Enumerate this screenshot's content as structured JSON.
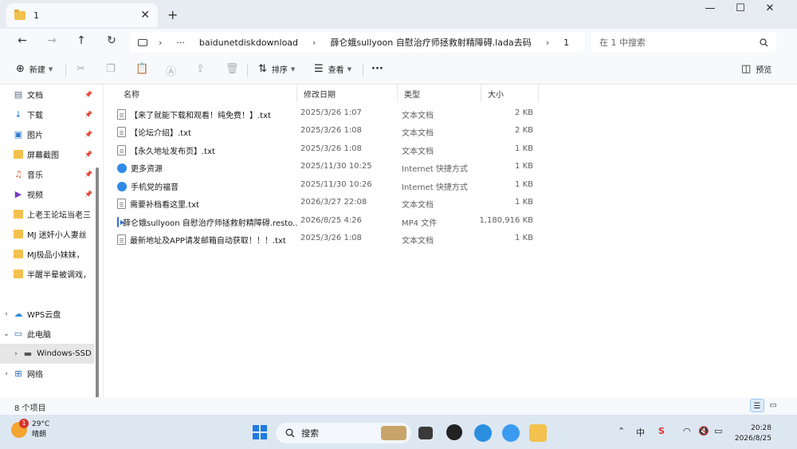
{
  "tab": {
    "title": "1"
  },
  "window": {
    "minimize": "—",
    "maximize": "☐",
    "close": "✕"
  },
  "address": {
    "more": "···",
    "crumbs": [
      "baidunetdiskdownload",
      "薛仑娥sullyoon 自慰治疗师拯救射精障碍.lada去码",
      "1"
    ],
    "sep": "›"
  },
  "search": {
    "placeholder": "在 1 中搜索"
  },
  "toolbar": {
    "new_label": "新建",
    "sort_label": "排序",
    "view_label": "查看",
    "more_label": "···",
    "preview_label": "预览"
  },
  "sidebar": {
    "items": [
      {
        "label": "文档",
        "icon": "document-icon",
        "pinned": true
      },
      {
        "label": "下载",
        "icon": "download-icon",
        "pinned": true
      },
      {
        "label": "图片",
        "icon": "image-icon",
        "pinned": true
      },
      {
        "label": "屏幕截图",
        "icon": "folder-icon",
        "pinned": true
      },
      {
        "label": "音乐",
        "icon": "music-icon",
        "pinned": true
      },
      {
        "label": "视频",
        "icon": "video-icon",
        "pinned": true
      },
      {
        "label": "上老王论坛当老三",
        "icon": "folder-icon",
        "pinned": false
      },
      {
        "label": "MJ 迷奸小人妻丝",
        "icon": "folder-icon",
        "pinned": false
      },
      {
        "label": "MJ极品小妹妹，",
        "icon": "folder-icon",
        "pinned": false
      },
      {
        "label": "半醒半晕被调戏，",
        "icon": "folder-icon",
        "pinned": false
      },
      {
        "label": "WPS云盘",
        "icon": "cloud-icon",
        "pinned": false
      },
      {
        "label": "此电脑",
        "icon": "computer-icon",
        "pinned": false
      },
      {
        "label": "Windows-SSD",
        "icon": "drive-icon",
        "pinned": false
      },
      {
        "label": "网络",
        "icon": "network-icon",
        "pinned": false
      }
    ]
  },
  "columns": {
    "name": "名称",
    "modified": "修改日期",
    "type": "类型",
    "size": "大小"
  },
  "files": [
    {
      "name": "【来了就能下载和观看！纯免费！】.txt",
      "modified": "2025/3/26 1:07",
      "type": "文本文档",
      "size": "2 KB",
      "icon": "text-file-icon"
    },
    {
      "name": "【论坛介绍】.txt",
      "modified": "2025/3/26 1:08",
      "type": "文本文档",
      "size": "2 KB",
      "icon": "text-file-icon"
    },
    {
      "name": "【永久地址发布页】.txt",
      "modified": "2025/3/26 1:08",
      "type": "文本文档",
      "size": "1 KB",
      "icon": "text-file-icon"
    },
    {
      "name": "更多资源",
      "modified": "2025/11/30 10:25",
      "type": "Internet 快捷方式",
      "size": "1 KB",
      "icon": "internet-shortcut-icon"
    },
    {
      "name": "手机党的福音",
      "modified": "2025/11/30 10:26",
      "type": "Internet 快捷方式",
      "size": "1 KB",
      "icon": "internet-shortcut-icon"
    },
    {
      "name": "需要补档看这里.txt",
      "modified": "2026/3/27 22:08",
      "type": "文本文档",
      "size": "1 KB",
      "icon": "text-file-icon"
    },
    {
      "name": "薛仑娥sullyoon 自慰治疗师拯救射精障碍.resto...",
      "modified": "2026/8/25 4:26",
      "type": "MP4 文件",
      "size": "1,180,916 KB",
      "icon": "video-file-icon"
    },
    {
      "name": "最新地址及APP请发邮箱自动获取！！！.txt",
      "modified": "2025/3/26 1:08",
      "type": "文本文档",
      "size": "1 KB",
      "icon": "text-file-icon"
    }
  ],
  "status": {
    "count": "8 个项目"
  },
  "taskbar": {
    "weather_temp": "29°C",
    "weather_desc": "晴朗",
    "weather_badge": "1",
    "search_label": "搜索",
    "ime": "中",
    "time": "20:28",
    "date": "2026/8/25"
  }
}
